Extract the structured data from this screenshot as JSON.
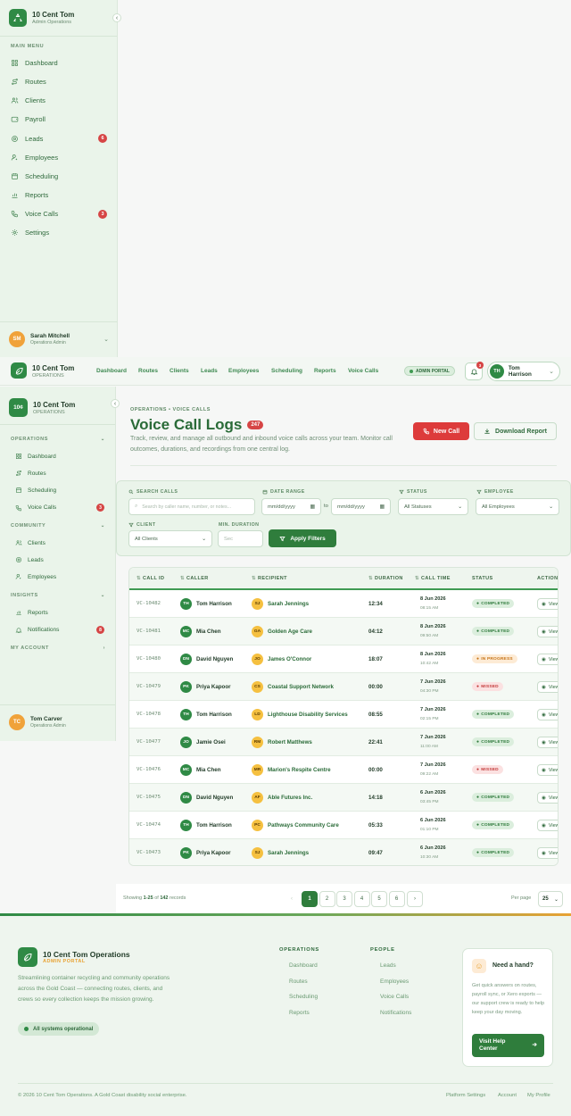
{
  "brand": {
    "name": "10 Cent Tom",
    "role": "Admin Operations",
    "sub": "OPERATIONS",
    "logo_text": "10¢"
  },
  "sidebar1": {
    "section": "MAIN MENU",
    "items": [
      {
        "label": "Dashboard",
        "icon": "grid-icon"
      },
      {
        "label": "Routes",
        "icon": "route-icon"
      },
      {
        "label": "Clients",
        "icon": "users-icon"
      },
      {
        "label": "Payroll",
        "icon": "wallet-icon"
      },
      {
        "label": "Leads",
        "icon": "target-icon",
        "badge": "6"
      },
      {
        "label": "Employees",
        "icon": "user-gear-icon"
      },
      {
        "label": "Scheduling",
        "icon": "calendar-icon"
      },
      {
        "label": "Reports",
        "icon": "chart-icon"
      },
      {
        "label": "Voice Calls",
        "icon": "phone-icon",
        "badge": "3"
      },
      {
        "label": "Settings",
        "icon": "gear-icon"
      }
    ],
    "user": {
      "initials": "SM",
      "name": "Sarah Mitchell",
      "role": "Operations Admin"
    }
  },
  "header": {
    "nav": [
      "Dashboard",
      "Routes",
      "Clients",
      "Leads",
      "Employees",
      "Scheduling",
      "Reports",
      "Voice Calls"
    ],
    "portal": "ADMIN PORTAL",
    "bell_count": "3",
    "user": {
      "initials": "TH",
      "name": "Tom Harrison"
    }
  },
  "sidebar2": {
    "sections": {
      "operations": "OPERATIONS",
      "community": "COMMUNITY",
      "insights": "INSIGHTS",
      "account": "MY ACCOUNT"
    },
    "operations": [
      {
        "label": "Dashboard"
      },
      {
        "label": "Routes"
      },
      {
        "label": "Scheduling"
      },
      {
        "label": "Voice Calls",
        "badge": "3"
      }
    ],
    "community": [
      {
        "label": "Clients"
      },
      {
        "label": "Leads"
      },
      {
        "label": "Employees"
      }
    ],
    "insights": [
      {
        "label": "Reports"
      },
      {
        "label": "Notifications",
        "badge": "8"
      }
    ],
    "user": {
      "initials": "TC",
      "name": "Tom Carver",
      "role": "Operations Admin"
    }
  },
  "page": {
    "breadcrumb": "OPERATIONS  •  VOICE CALLS",
    "title": "Voice Call Logs",
    "count": "247",
    "description": "Track, review, and manage all outbound and inbound voice calls across your team. Monitor call outcomes, durations, and recordings from one central log.",
    "new_call": "New Call",
    "download": "Download Report"
  },
  "filters": {
    "search_label": "SEARCH CALLS",
    "search_placeholder": "Search by caller name, number, or notes...",
    "date_label": "DATE RANGE",
    "date_from": "mm/dd/yyyy",
    "date_to_word": "to",
    "date_to": "mm/dd/yyyy",
    "status_label": "STATUS",
    "status_value": "All Statuses",
    "employee_label": "EMPLOYEE",
    "employee_value": "All Employees",
    "client_label": "CLIENT",
    "client_value": "All Clients",
    "duration_label": "MIN. DURATION",
    "duration_placeholder": "Sec",
    "apply": "Apply Filters"
  },
  "table": {
    "headers": [
      "CALL ID",
      "CALLER",
      "RECIPIENT",
      "DURATION",
      "CALL TIME",
      "STATUS",
      "ACTIONS"
    ],
    "view_label": "View",
    "rows": [
      {
        "id": "VC-10482",
        "ci": "TH",
        "caller": "Tom Harrison",
        "ri": "SJ",
        "recipient": "Sarah Jennings",
        "duration": "12:34",
        "date": "8 Jun 2026",
        "time": "08:15 AM",
        "status": "COMPLETED",
        "kind": "ok"
      },
      {
        "id": "VC-10481",
        "ci": "MC",
        "caller": "Mia Chen",
        "ri": "GA",
        "recipient": "Golden Age Care",
        "duration": "04:12",
        "date": "8 Jun 2026",
        "time": "09:50 AM",
        "status": "COMPLETED",
        "kind": "ok"
      },
      {
        "id": "VC-10480",
        "ci": "DN",
        "caller": "David Nguyen",
        "ri": "JO",
        "recipient": "James O'Connor",
        "duration": "18:07",
        "date": "8 Jun 2026",
        "time": "10:42 AM",
        "status": "IN PROGRESS",
        "kind": "ip"
      },
      {
        "id": "VC-10479",
        "ci": "PK",
        "caller": "Priya Kapoor",
        "ri": "CS",
        "recipient": "Coastal Support Network",
        "duration": "00:00",
        "date": "7 Jun 2026",
        "time": "04:30 PM",
        "status": "MISSED",
        "kind": "ms"
      },
      {
        "id": "VC-10478",
        "ci": "TH",
        "caller": "Tom Harrison",
        "ri": "LD",
        "recipient": "Lighthouse Disability Services",
        "duration": "08:55",
        "date": "7 Jun 2026",
        "time": "02:15 PM",
        "status": "COMPLETED",
        "kind": "ok"
      },
      {
        "id": "VC-10477",
        "ci": "JO",
        "caller": "Jamie Osei",
        "ri": "RM",
        "recipient": "Robert Matthews",
        "duration": "22:41",
        "date": "7 Jun 2026",
        "time": "11:00 AM",
        "status": "COMPLETED",
        "kind": "ok"
      },
      {
        "id": "VC-10476",
        "ci": "MC",
        "caller": "Mia Chen",
        "ri": "MR",
        "recipient": "Marion's Respite Centre",
        "duration": "00:00",
        "date": "7 Jun 2026",
        "time": "09:22 AM",
        "status": "MISSED",
        "kind": "ms"
      },
      {
        "id": "VC-10475",
        "ci": "DN",
        "caller": "David Nguyen",
        "ri": "AF",
        "recipient": "Able Futures Inc.",
        "duration": "14:18",
        "date": "6 Jun 2026",
        "time": "03:45 PM",
        "status": "COMPLETED",
        "kind": "ok"
      },
      {
        "id": "VC-10474",
        "ci": "TH",
        "caller": "Tom Harrison",
        "ri": "PC",
        "recipient": "Pathways Community Care",
        "duration": "05:33",
        "date": "6 Jun 2026",
        "time": "01:10 PM",
        "status": "COMPLETED",
        "kind": "ok"
      },
      {
        "id": "VC-10473",
        "ci": "PK",
        "caller": "Priya Kapoor",
        "ri": "SJ",
        "recipient": "Sarah Jennings",
        "duration": "09:47",
        "date": "6 Jun 2026",
        "time": "10:30 AM",
        "status": "COMPLETED",
        "kind": "ok"
      }
    ]
  },
  "pagination": {
    "showing": "Showing",
    "range": "1-25",
    "of": "of",
    "total": "142",
    "records": "records",
    "pages": [
      "1",
      "2",
      "3",
      "4",
      "5",
      "6"
    ],
    "per_page_label": "Per page",
    "per_page": "25"
  },
  "footer": {
    "title": "10 Cent Tom Operations",
    "subtitle": "ADMIN PORTAL",
    "blurb": "Streamlining container recycling and community operations across the Gold Coast — connecting routes, clients, and crews so every collection keeps the mission growing.",
    "status": "All systems operational",
    "ops_head": "OPERATIONS",
    "ops": [
      "Dashboard",
      "Routes",
      "Scheduling",
      "Reports"
    ],
    "people_head": "PEOPLE",
    "people": [
      "Leads",
      "Employees",
      "Voice Calls",
      "Notifications"
    ],
    "help_title": "Need a hand?",
    "help_text": "Get quick answers on routes, payroll sync, or Xero exports — our support crew is ready to help keep your day moving.",
    "help_btn": "Visit Help Center",
    "copyright": "© 2026 10 Cent Tom Operations. A Gold Coast disability social enterprise.",
    "links": [
      "Platform Settings",
      "Account",
      "My Profile"
    ]
  },
  "colors": {
    "accent": "#2f7d3c",
    "danger": "#dd3b3b",
    "warning": "#e8a234"
  }
}
